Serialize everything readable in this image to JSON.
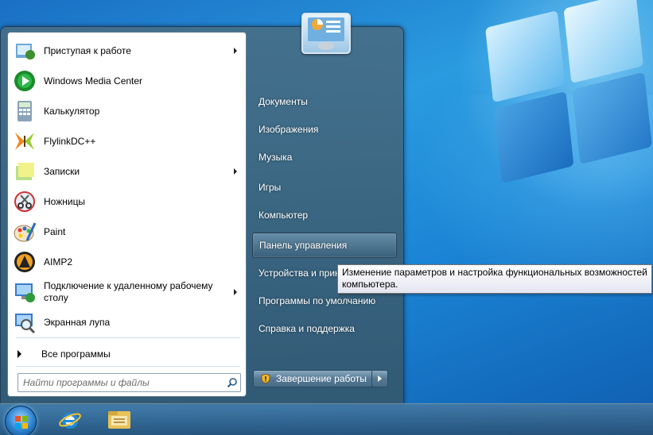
{
  "start_menu": {
    "programs": [
      {
        "label": "Приступая к работе",
        "icon": "getting-started-icon",
        "has_submenu": true
      },
      {
        "label": "Windows Media Center",
        "icon": "media-center-icon",
        "has_submenu": false
      },
      {
        "label": "Калькулятор",
        "icon": "calculator-icon",
        "has_submenu": false
      },
      {
        "label": "FlylinkDC++",
        "icon": "flylinkdc-icon",
        "has_submenu": false
      },
      {
        "label": "Записки",
        "icon": "sticky-notes-icon",
        "has_submenu": true
      },
      {
        "label": "Ножницы",
        "icon": "snipping-tool-icon",
        "has_submenu": false
      },
      {
        "label": "Paint",
        "icon": "paint-icon",
        "has_submenu": false
      },
      {
        "label": "AIMP2",
        "icon": "aimp-icon",
        "has_submenu": false
      },
      {
        "label": "Подключение к удаленному рабочему столу",
        "icon": "remote-desktop-icon",
        "has_submenu": true
      },
      {
        "label": "Экранная лупа",
        "icon": "magnifier-icon",
        "has_submenu": false
      }
    ],
    "all_programs_label": "Все программы",
    "search_placeholder": "Найти программы и файлы",
    "right_items": [
      {
        "label": "Документы"
      },
      {
        "label": "Изображения"
      },
      {
        "label": "Музыка"
      },
      {
        "label": "Игры"
      },
      {
        "label": "Компьютер"
      },
      {
        "label": "Панель управления",
        "highlighted": true
      },
      {
        "label": "Устройства и принтеры"
      },
      {
        "label": "Программы по умолчанию"
      },
      {
        "label": "Справка и поддержка"
      }
    ],
    "shutdown_label": "Завершение работы"
  },
  "tooltip": {
    "text": "Изменение параметров и настройка функциональных возможностей компьютера."
  },
  "taskbar": {
    "pinned": [
      {
        "icon": "internet-explorer-icon"
      },
      {
        "icon": "explorer-folder-icon"
      }
    ]
  },
  "colors": {
    "desktop": "#1c86d6",
    "menu_glass": "#4a6c87",
    "highlight": "#8aafc8"
  }
}
